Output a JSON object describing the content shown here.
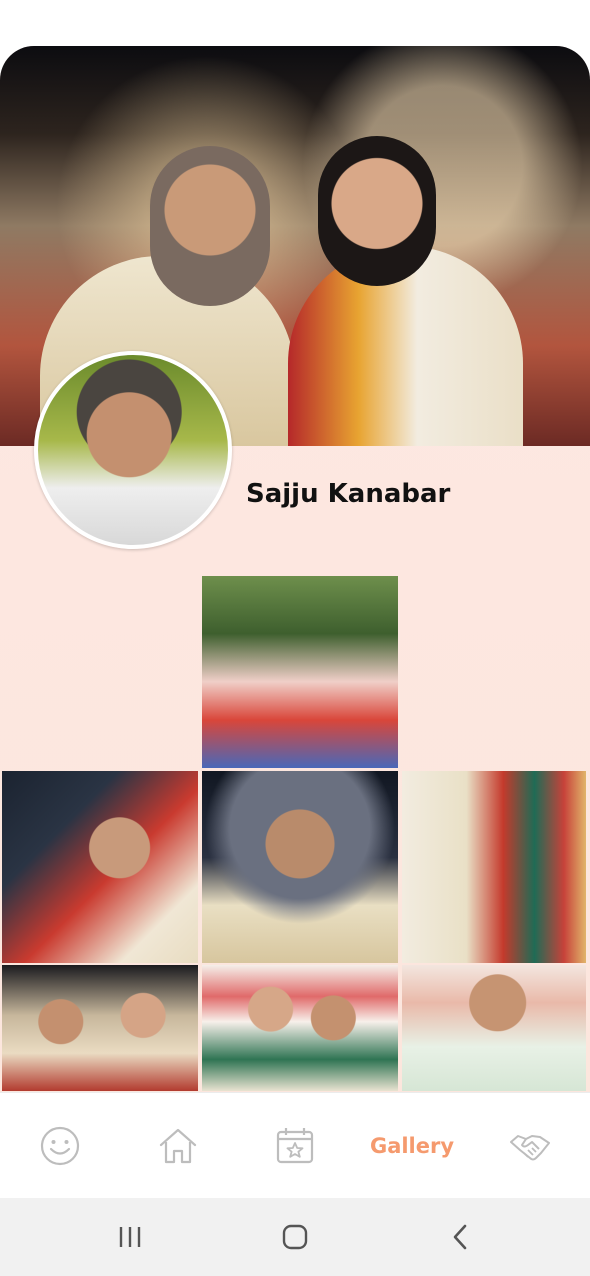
{
  "profile": {
    "name": "Sajju Kanabar"
  },
  "bottom_nav": {
    "items": [
      {
        "icon": "smiley-icon"
      },
      {
        "icon": "home-icon"
      },
      {
        "icon": "calendar-icon"
      },
      {
        "label": "Gallery",
        "active": true
      },
      {
        "icon": "handshake-icon"
      }
    ],
    "accent_color": "#f59a6e",
    "inactive_color": "#b9b9b9"
  },
  "system_nav": {
    "buttons": [
      "recents-icon",
      "home-circle-icon",
      "back-icon"
    ]
  }
}
